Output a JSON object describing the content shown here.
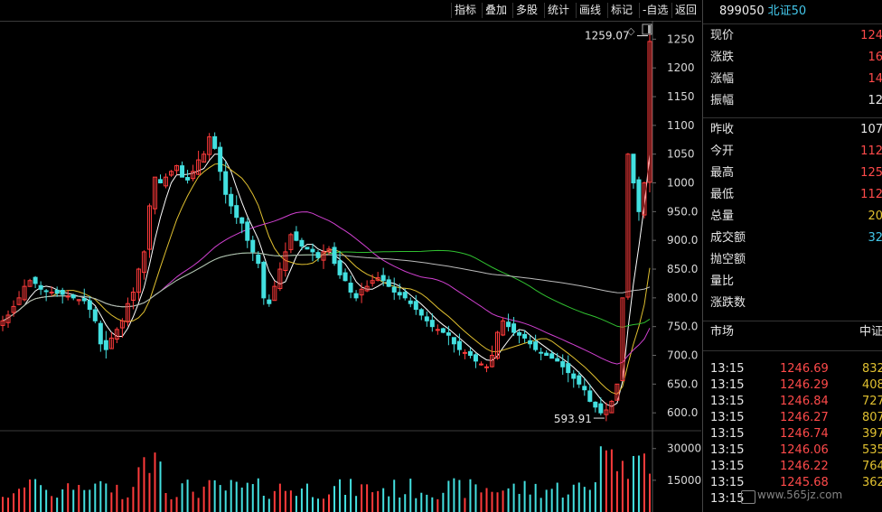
{
  "toolbar": {
    "items": [
      "指标",
      "叠加",
      "多股",
      "统计",
      "画线",
      "标记",
      "-自选",
      "返回"
    ]
  },
  "header": {
    "code": "899050",
    "name": "北证50"
  },
  "quote": {
    "rows": [
      {
        "label": "现价",
        "value": "124",
        "color": "#ff4a4a"
      },
      {
        "label": "涨跌",
        "value": "16",
        "color": "#ff4a4a"
      },
      {
        "label": "涨幅",
        "value": "14",
        "color": "#ff4a4a"
      },
      {
        "label": "振幅",
        "value": "12",
        "color": "#e6e6e6"
      },
      {
        "label": "昨收",
        "value": "107",
        "color": "#e6e6e6"
      },
      {
        "label": "今开",
        "value": "112",
        "color": "#ff4a4a"
      },
      {
        "label": "最高",
        "value": "125",
        "color": "#ff4a4a"
      },
      {
        "label": "最低",
        "value": "112",
        "color": "#ff4a4a"
      },
      {
        "label": "总量",
        "value": "20",
        "color": "#e0c030"
      },
      {
        "label": "成交额",
        "value": "32",
        "color": "#43c6e9"
      },
      {
        "label": "抛空额",
        "value": "",
        "color": "#e6e6e6"
      },
      {
        "label": "量比",
        "value": "",
        "color": "#e6e6e6"
      },
      {
        "label": "涨跌数",
        "value": "",
        "color": "#e6e6e6"
      }
    ]
  },
  "market": {
    "label": "市场",
    "value": "中证"
  },
  "ticks": [
    {
      "time": "13:15",
      "price": "1246.69",
      "vol": "832"
    },
    {
      "time": "13:15",
      "price": "1246.29",
      "vol": "408"
    },
    {
      "time": "13:15",
      "price": "1246.84",
      "vol": "727"
    },
    {
      "time": "13:15",
      "price": "1246.27",
      "vol": "807"
    },
    {
      "time": "13:15",
      "price": "1246.74",
      "vol": "397"
    },
    {
      "time": "13:15",
      "price": "1246.06",
      "vol": "535"
    },
    {
      "time": "13:15",
      "price": "1246.22",
      "vol": "764"
    },
    {
      "time": "13:15",
      "price": "1245.68",
      "vol": "362"
    },
    {
      "time": "13:15",
      "price": "",
      "vol": ""
    }
  ],
  "watermark": "www.565jz.com",
  "chart_data": {
    "type": "candlestick",
    "price_axis": {
      "ticks": [
        1250,
        1200,
        1150,
        1100,
        1050,
        1000,
        950,
        900,
        850,
        800,
        750,
        700,
        650,
        600
      ],
      "labels": [
        "1250",
        "1200",
        "1150",
        "1100",
        "1050",
        "1000",
        "950.0",
        "900.0",
        "850.0",
        "800.0",
        "750.0",
        "700.0",
        "650.0",
        "600.0"
      ],
      "ylim": [
        572,
        1282
      ]
    },
    "volume_axis": {
      "ticks": [
        30000,
        15000
      ],
      "labels": [
        "30000",
        "15000"
      ],
      "ylim": [
        0,
        38000
      ]
    },
    "annotations": [
      {
        "text": "1259.07",
        "value": 1259.07,
        "index": 119
      },
      {
        "text": "593.91",
        "value": 593.91,
        "index": 111
      }
    ],
    "close": [
      760,
      770,
      785,
      800,
      820,
      830,
      825,
      815,
      812,
      810,
      808,
      806,
      803,
      800,
      797,
      795,
      780,
      760,
      720,
      710,
      730,
      745,
      760,
      790,
      810,
      850,
      880,
      960,
      1010,
      1000,
      1010,
      1020,
      1030,
      1010,
      1005,
      1020,
      1040,
      1050,
      1080,
      1060,
      1020,
      980,
      960,
      940,
      930,
      900,
      880,
      860,
      800,
      790,
      820,
      850,
      880,
      910,
      900,
      890,
      885,
      880,
      870,
      880,
      885,
      860,
      840,
      830,
      810,
      800,
      815,
      820,
      830,
      835,
      830,
      820,
      810,
      805,
      800,
      790,
      780,
      770,
      760,
      750,
      745,
      740,
      735,
      720,
      710,
      705,
      700,
      690,
      685,
      680,
      700,
      740,
      760,
      750,
      740,
      735,
      730,
      720,
      710,
      705,
      700,
      695,
      690,
      680,
      670,
      660,
      650,
      640,
      620,
      610,
      600,
      605,
      620,
      650,
      800,
      1050,
      1000,
      950,
      1000,
      1246
    ]
  }
}
